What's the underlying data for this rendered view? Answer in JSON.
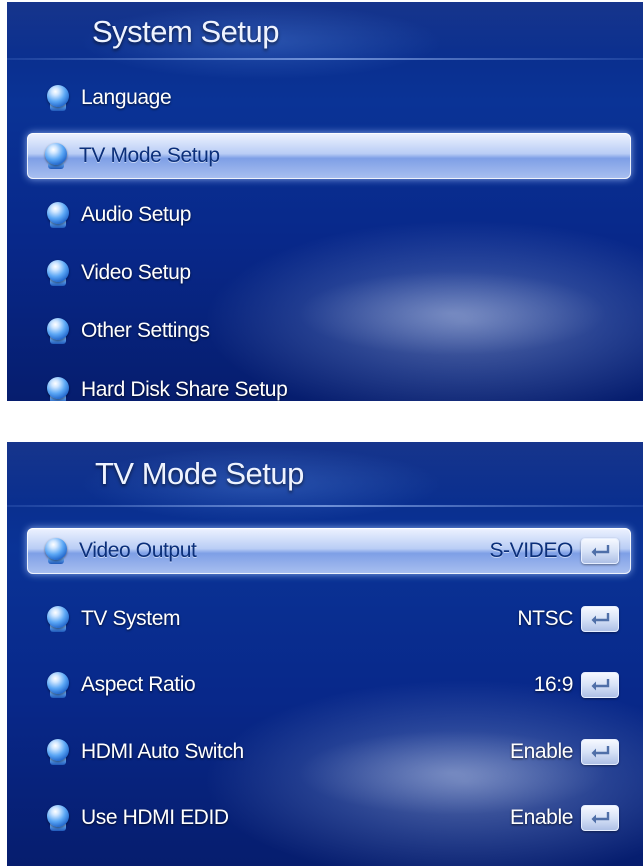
{
  "system_setup": {
    "title": "System Setup",
    "items": [
      {
        "label": "Language",
        "selected": false
      },
      {
        "label": "TV Mode Setup",
        "selected": true
      },
      {
        "label": "Audio Setup",
        "selected": false
      },
      {
        "label": "Video Setup",
        "selected": false
      },
      {
        "label": "Other Settings",
        "selected": false
      },
      {
        "label": "Hard Disk Share Setup",
        "selected": false
      }
    ]
  },
  "tv_mode_setup": {
    "title": "TV Mode Setup",
    "items": [
      {
        "label": "Video Output",
        "value": "S-VIDEO",
        "selected": true
      },
      {
        "label": "TV System",
        "value": "NTSC",
        "selected": false
      },
      {
        "label": "Aspect Ratio",
        "value": "16:9",
        "selected": false
      },
      {
        "label": "HDMI Auto Switch",
        "value": "Enable",
        "selected": false
      },
      {
        "label": "Use HDMI EDID",
        "value": "Enable",
        "selected": false
      }
    ]
  },
  "icons": {
    "menu_bullet": "orb-bullet-icon",
    "enter_button": "enter-return-icon"
  },
  "colors": {
    "background": "#0a2a86",
    "highlight": "#b9cdf5",
    "text": "#ffffff",
    "selected_text": "#0b2f7a"
  }
}
